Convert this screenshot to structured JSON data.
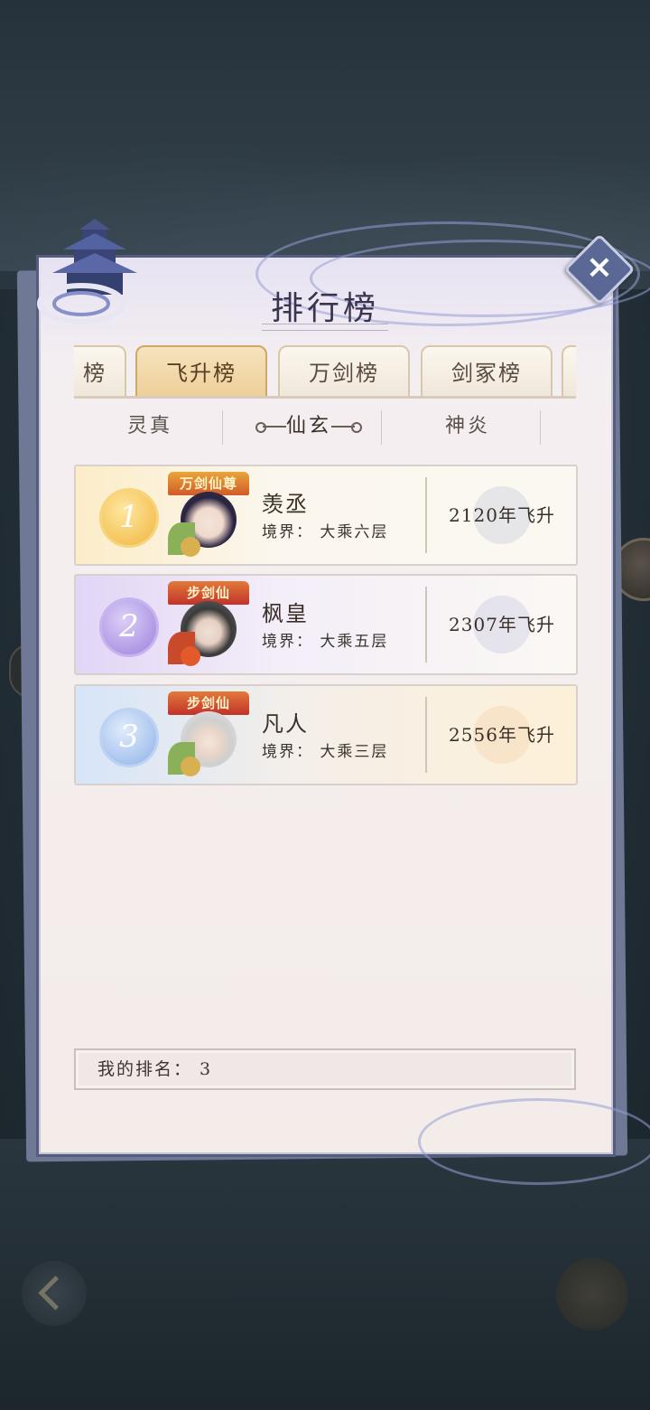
{
  "title": "排行榜",
  "close_icon": "×",
  "tabs": [
    {
      "label": "榜",
      "active": false
    },
    {
      "label": "飞升榜",
      "active": true
    },
    {
      "label": "万剑榜",
      "active": false
    },
    {
      "label": "剑冢榜",
      "active": false
    }
  ],
  "subtabs": [
    {
      "label": "灵真",
      "active": false
    },
    {
      "label": "仙玄",
      "active": true
    },
    {
      "label": "神炎",
      "active": false
    }
  ],
  "rankings": [
    {
      "rank": "1",
      "title_badge": "万剑仙尊",
      "name": "羡丞",
      "realm": "境界： 大乘六层",
      "ascension": "2120年飞升",
      "theme": "gold"
    },
    {
      "rank": "2",
      "title_badge": "步剑仙",
      "name": "枫皇",
      "realm": "境界： 大乘五层",
      "ascension": "2307年飞升",
      "theme": "purple"
    },
    {
      "rank": "3",
      "title_badge": "步剑仙",
      "name": "凡人",
      "realm": "境界： 大乘三层",
      "ascension": "2556年飞升",
      "theme": "blue"
    }
  ],
  "my_rank": {
    "label": "我的排名：",
    "value": "3",
    "text": "我的排名： 3"
  },
  "colors": {
    "panel_border": "#555d7e",
    "gold": "#f4c45a",
    "purple": "#a88ee0",
    "blue": "#8fb6ea",
    "active_tab": "#edcf98"
  }
}
